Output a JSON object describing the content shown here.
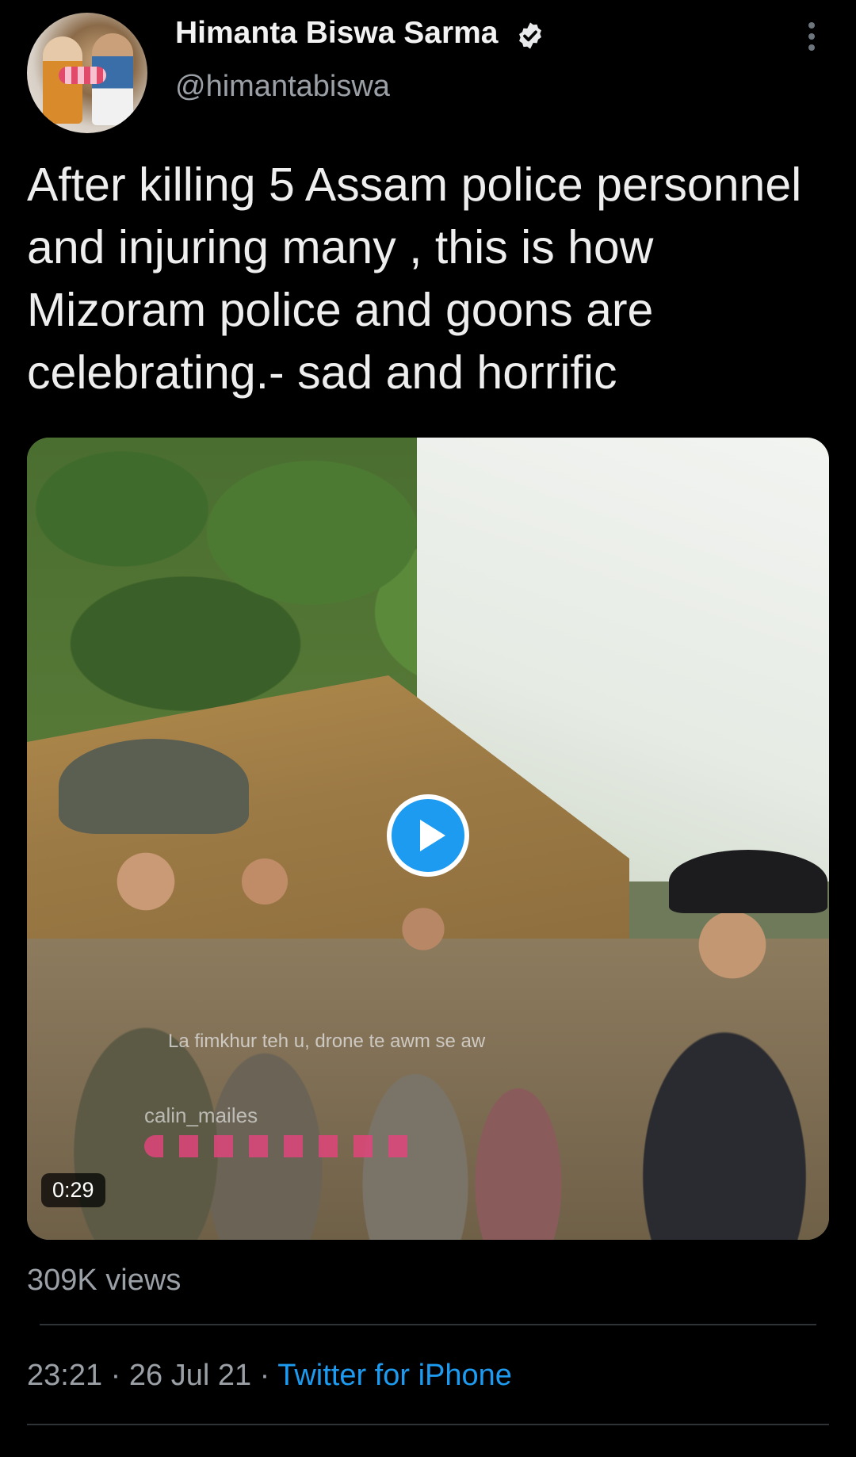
{
  "user": {
    "display_name": "Himanta Biswa Sarma",
    "handle": "@himantabiswa",
    "verified": true
  },
  "tweet": {
    "text": "After killing 5 Assam police personnel and injuring many , this is how Mizoram police and goons are celebrating.- sad and horrific"
  },
  "media": {
    "type": "video",
    "duration": "0:29",
    "overlay_caption": "La fimkhur teh u, drone te awm se aw",
    "overlay_user": "calin_mailes"
  },
  "stats": {
    "views": "309K views"
  },
  "meta": {
    "time": "23:21",
    "separator1": " · ",
    "date": "26 Jul 21",
    "separator2": " · ",
    "source": "Twitter for iPhone"
  },
  "colors": {
    "background": "#000000",
    "accent": "#1d9bf0",
    "secondary_text": "#9aa0a6"
  },
  "icons": [
    "verified-badge-icon",
    "more-options-icon",
    "play-icon"
  ]
}
